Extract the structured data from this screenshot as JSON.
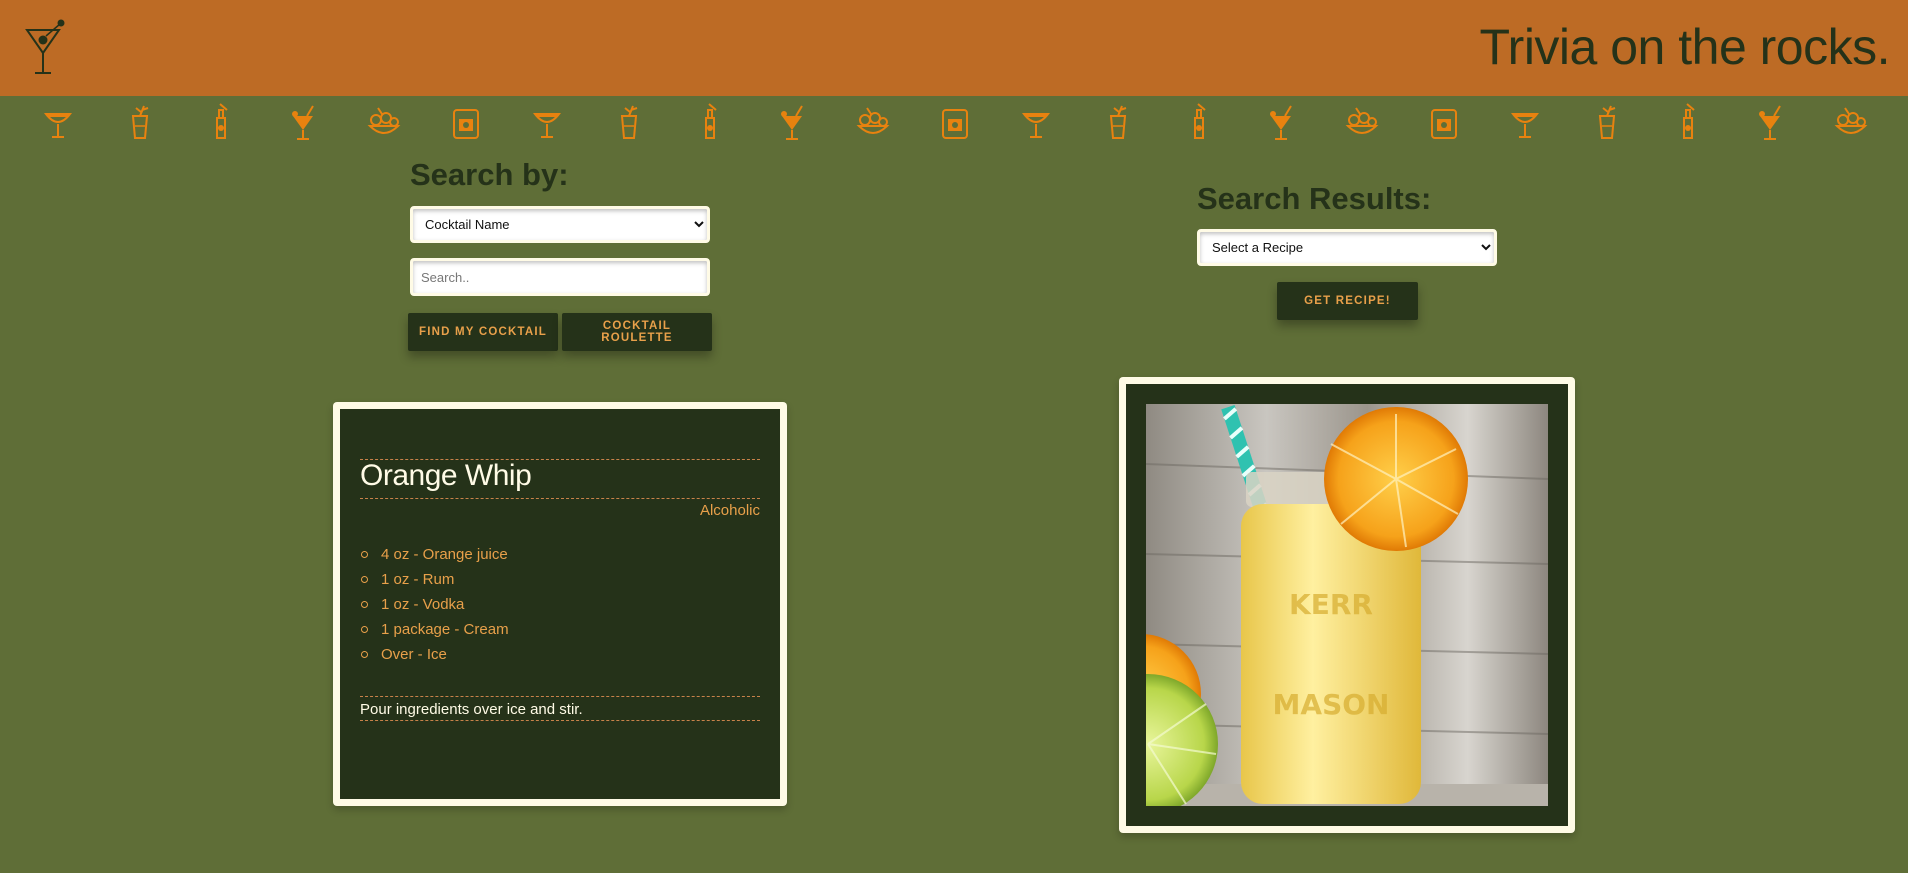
{
  "header": {
    "title": "Trivia on the rocks.",
    "logo_icon": "martini-glass-icon",
    "background_color": "#bd6b25"
  },
  "icon_strip": {
    "pattern": [
      "coupe-glass-icon",
      "highball-sprig-icon",
      "bottle-lemon-icon",
      "cocktail-straw-icon",
      "fruit-bowl-icon",
      "rocks-glass-icon"
    ],
    "color": "#e8820f"
  },
  "search": {
    "heading": "Search by:",
    "search_by_options": [
      "Cocktail Name"
    ],
    "search_by_selected": "Cocktail Name",
    "search_placeholder": "Search..",
    "search_value": "",
    "find_button": "Find My Cocktail",
    "roulette_button": "Cocktail Roulette"
  },
  "results": {
    "heading": "Search Results:",
    "recipe_select_options": [
      "Select a Recipe"
    ],
    "recipe_select_selected": "Select a Recipe",
    "get_recipe_button": "Get Recipe!"
  },
  "recipe": {
    "name": "Orange Whip",
    "type": "Alcoholic",
    "ingredients": [
      "4 oz - Orange juice",
      "1 oz - Rum",
      "1 oz - Vodka",
      "1 package - Cream",
      "Over - Ice"
    ],
    "instructions": "Pour ingredients over ice and stir."
  },
  "photo": {
    "alt": "Orange Whip",
    "mason_jar_text": [
      "KERR",
      "MASON"
    ]
  },
  "colors": {
    "page_background": "#5f6e37",
    "dark_green": "#253219",
    "cream": "#fffbe6",
    "accent_orange": "#e8a04a"
  }
}
